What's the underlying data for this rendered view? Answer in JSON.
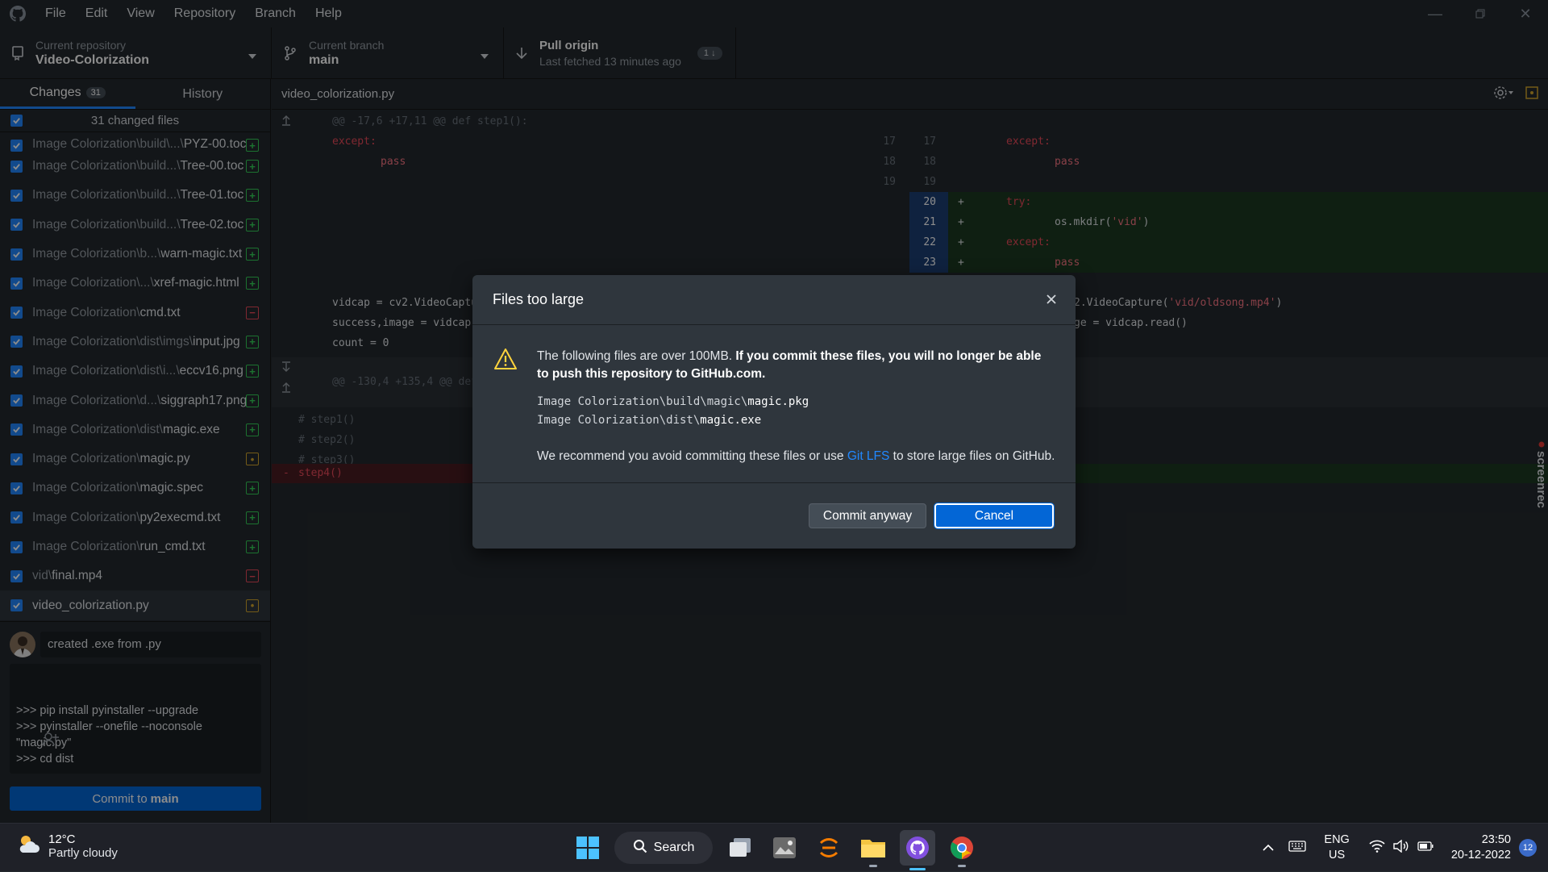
{
  "titlebar": {
    "menu": [
      "File",
      "Edit",
      "View",
      "Repository",
      "Branch",
      "Help"
    ]
  },
  "toolbar": {
    "repo_label": "Current repository",
    "repo_value": "Video-Colorization",
    "branch_label": "Current branch",
    "branch_value": "main",
    "pull_label": "Pull origin",
    "pull_sub": "Last fetched 13 minutes ago",
    "pull_count": "1 ↓"
  },
  "sidebar": {
    "tab_changes": "Changes",
    "tab_changes_count": "31",
    "tab_history": "History",
    "changed_files": "31 changed files",
    "files": [
      {
        "prefix": "Image Colorization\\build\\...\\",
        "name": "PYZ-00.toc",
        "status": "add"
      },
      {
        "prefix": "Image Colorization\\build...\\",
        "name": "Tree-00.toc",
        "status": "add"
      },
      {
        "prefix": "Image Colorization\\build...\\",
        "name": "Tree-01.toc",
        "status": "add"
      },
      {
        "prefix": "Image Colorization\\build...\\",
        "name": "Tree-02.toc",
        "status": "add"
      },
      {
        "prefix": "Image Colorization\\b...\\",
        "name": "warn-magic.txt",
        "status": "add"
      },
      {
        "prefix": "Image Colorization\\...\\",
        "name": "xref-magic.html",
        "status": "add"
      },
      {
        "prefix": "Image Colorization\\",
        "name": "cmd.txt",
        "status": "del"
      },
      {
        "prefix": "Image Colorization\\dist\\imgs\\",
        "name": "input.jpg",
        "status": "add"
      },
      {
        "prefix": "Image Colorization\\dist\\i...\\",
        "name": "eccv16.png",
        "status": "add"
      },
      {
        "prefix": "Image Colorization\\d...\\",
        "name": "siggraph17.png",
        "status": "add"
      },
      {
        "prefix": "Image Colorization\\dist\\",
        "name": "magic.exe",
        "status": "add"
      },
      {
        "prefix": "Image Colorization\\",
        "name": "magic.py",
        "status": "mod"
      },
      {
        "prefix": "Image Colorization\\",
        "name": "magic.spec",
        "status": "add"
      },
      {
        "prefix": "Image Colorization\\",
        "name": "py2execmd.txt",
        "status": "add"
      },
      {
        "prefix": "Image Colorization\\",
        "name": "run_cmd.txt",
        "status": "add"
      },
      {
        "prefix": "vid\\",
        "name": "final.mp4",
        "status": "del"
      },
      {
        "prefix": "",
        "name": "video_colorization.py",
        "status": "mod"
      }
    ],
    "summary": "created .exe from .py",
    "description": ">>> pip install pyinstaller --upgrade\n>>> pyinstaller --onefile --noconsole \"magic.py\"\n>>> cd dist",
    "commit_prefix": "Commit to",
    "commit_branch": "main"
  },
  "diff": {
    "filename": "video_colorization.py",
    "hunk1": "@@ -17,6 +17,11 @@ def step1():",
    "hunk2": "@@ -130,4 +135,4 @@ def",
    "left": {
      "except": "except:",
      "pass": "pass",
      "vidcap": "vidcap = cv2.VideoCaptu",
      "success": "success,image = vidcap.",
      "count": "count = 0",
      "c1": "# step1()",
      "c2": "# step2()",
      "c3": "# step3()",
      "removed_marker": "-",
      "removed": "step4()"
    },
    "line_numbers_left": [
      "17",
      "18",
      "19"
    ],
    "line_numbers_right": [
      "17",
      "18",
      "19",
      "20",
      "21",
      "22",
      "23"
    ],
    "right": {
      "except": "except:",
      "pass": "pass",
      "try": "try:",
      "mkdir_pre": "os.mkdir(",
      "mkdir_arg": "'vid'",
      "mkdir_post": ")",
      "except2": "except:",
      "pass2": "pass",
      "vidcap_pre": "2.VideoCapture(",
      "vidcap_arg": "'vid/oldsong.mp4'",
      "vidcap_post": ")",
      "read": "ge = vidcap.read()",
      "plus": "+"
    }
  },
  "modal": {
    "title": "Files too large",
    "msg_plain": "The following files are over 100MB. ",
    "msg_bold": "If you commit these files, you will no longer be able to push this repository to GitHub.com.",
    "file1_prefix": "Image Colorization\\build\\magic\\",
    "file1_name": "magic.pkg",
    "file2_prefix": "Image Colorization\\dist\\",
    "file2_name": "magic.exe",
    "rec_pre": "We recommend you avoid committing these files or use ",
    "rec_link": "Git LFS",
    "rec_post": " to store large files on GitHub.",
    "btn_anyway": "Commit anyway",
    "btn_cancel": "Cancel"
  },
  "screenrec": "screenrec",
  "taskbar": {
    "temp": "12°C",
    "weather": "Partly cloudy",
    "search": "Search",
    "lang1": "ENG",
    "lang2": "US",
    "time": "23:50",
    "date": "20-12-2022",
    "notifications": "12"
  }
}
